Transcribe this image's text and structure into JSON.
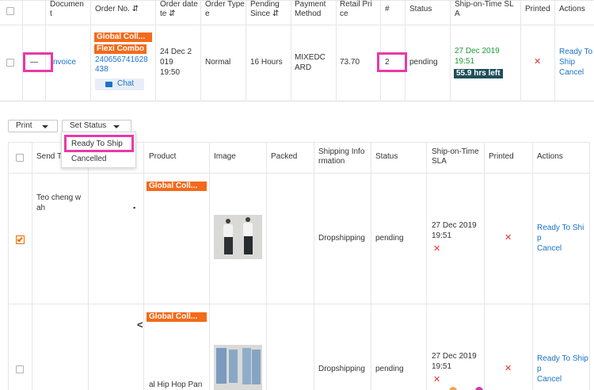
{
  "top_table": {
    "headers": {
      "document": "Documen\nt",
      "order_no": "Order No. ⇵",
      "order_date": "Order date\nte ⇵",
      "order_type": "Order Type\ne",
      "pending_since": "Pending\nSince ⇵",
      "payment_method": "Payment\nMethod",
      "retail_price": "Retail Pri\nce",
      "count": "#",
      "status": "Status",
      "sla": "Ship-on-Time SL\nA",
      "printed": "Printed",
      "actions": "Actions"
    },
    "row": {
      "document_dash": "—",
      "invoice_link": "nvoice",
      "tag1": "Global Coll...",
      "tag2": "Flexi Combo",
      "order_number": "240656741628\n438",
      "chat_label": "Chat",
      "order_date": "24 Dec 2\n019\n19:50",
      "order_type": "Normal",
      "pending_since": "16 Hours",
      "payment_method": "MIXEDC\nARD",
      "retail_price": "73.70",
      "count": "2",
      "status": "pending",
      "sla_date": "27 Dec 2019\n19:51",
      "sla_badge": "55.9 hrs left",
      "printed_mark": "✕",
      "action_ready": "Ready To\nShip",
      "action_cancel": "Cancel"
    }
  },
  "toolbar": {
    "print_label": "Print",
    "set_status_label": "Set Status",
    "dropdown": {
      "options": [
        "Ready To Ship",
        "Cancelled"
      ]
    }
  },
  "sub_table": {
    "headers": {
      "send_to": "Send T",
      "product": "Product",
      "image": "Image",
      "packed": "Packed",
      "shipping_info": "Shipping Info\nrmation",
      "status": "Status",
      "sla": "Ship-on-Time\nSLA",
      "printed": "Printed",
      "actions": "Actions"
    },
    "rows": [
      {
        "customer": "Teo cheng w\nah",
        "mark": "▪",
        "tag": "Global Coll...",
        "product_name": "",
        "shipping": "Dropshipping",
        "status": "pending",
        "sla_date": "27 Dec 2019\n19:51",
        "sla_mark": "✕",
        "printed_mark": "✕",
        "action_ready": "Ready To Shi\np",
        "action_cancel": "Cancel"
      },
      {
        "customer": "",
        "mark": "<",
        "tag": "Global Coll...",
        "product_name": "al Hip Hop Pan",
        "shipping": "Dropshipping",
        "status": "pending",
        "sla_date": "27 Dec 2019\n19:51",
        "sla_mark": "✕",
        "printed_mark": "✕",
        "action_ready": "Ready To Ship\np",
        "action_cancel": "Cancel"
      }
    ]
  },
  "colors": {
    "tag_orange": "#f36a1a",
    "highlight_pink": "#e83aa6",
    "link_blue": "#1a73c8",
    "sla_green": "#1e9a3a",
    "sla_badge_bg": "#1f4e5a",
    "error_red": "#e23030"
  }
}
